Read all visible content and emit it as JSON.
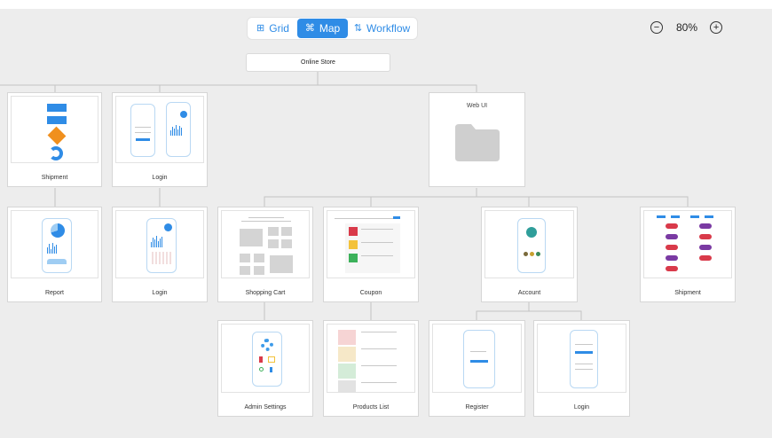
{
  "toolbar": {
    "view_modes": [
      {
        "label": "Grid",
        "icon": "grid-icon",
        "active": false
      },
      {
        "label": "Map",
        "icon": "map-icon",
        "active": true
      },
      {
        "label": "Workflow",
        "icon": "workflow-icon",
        "active": false
      }
    ],
    "zoom": {
      "value": "80%",
      "zoom_out_icon": "minus-circle-icon",
      "zoom_in_icon": "plus-circle-icon"
    }
  },
  "map": {
    "root": "Online Store",
    "screens": {
      "shipment_1": "Shipment",
      "login_1": "Login",
      "web_ui": "Web UI",
      "report": "Report",
      "login_2": "Login",
      "shopping_cart": "Shopping Cart",
      "coupon": "Coupon",
      "account": "Account",
      "shipment_2": "Shipment",
      "admin_settings": "Admin Settings",
      "products_list": "Products List",
      "register": "Register",
      "login_3": "Login"
    }
  },
  "colors": {
    "accent": "#2f8ce6",
    "canvas": "#ededed",
    "orange": "#f0901e",
    "red": "#d93a4a",
    "purple": "#7a3aa3",
    "green": "#3cb15a",
    "yellow": "#f3c23a"
  }
}
